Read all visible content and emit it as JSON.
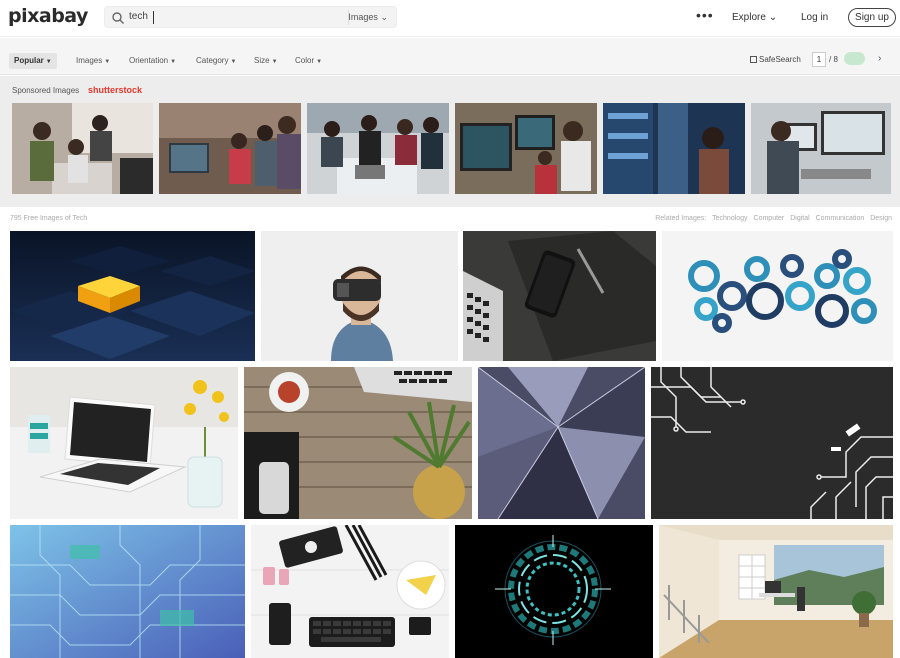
{
  "header": {
    "logo": "pixabay",
    "search_value": "tech",
    "search_type": "Images",
    "more_label": "•••",
    "explore_label": "Explore",
    "login_label": "Log in",
    "signup_label": "Sign up"
  },
  "filters": {
    "popular": "Popular",
    "images": "Images",
    "orientation": "Orientation",
    "category": "Category",
    "size": "Size",
    "color": "Color",
    "safesearch": "SafeSearch",
    "page_current": "1",
    "page_total": "/ 8"
  },
  "sponsored": {
    "label": "Sponsored Images",
    "brand": "shutterstock"
  },
  "results": {
    "count_label": "795 Free Images of Tech",
    "related_label": "Related Images:",
    "related": [
      "Technology",
      "Computer",
      "Digital",
      "Communication",
      "Design"
    ]
  },
  "colors": {
    "accent_green": "#c7e8cf",
    "brand_red": "#e2372c"
  },
  "icons": [
    "search-icon",
    "chevron-down-icon",
    "more-icon",
    "chevron-right-icon"
  ]
}
